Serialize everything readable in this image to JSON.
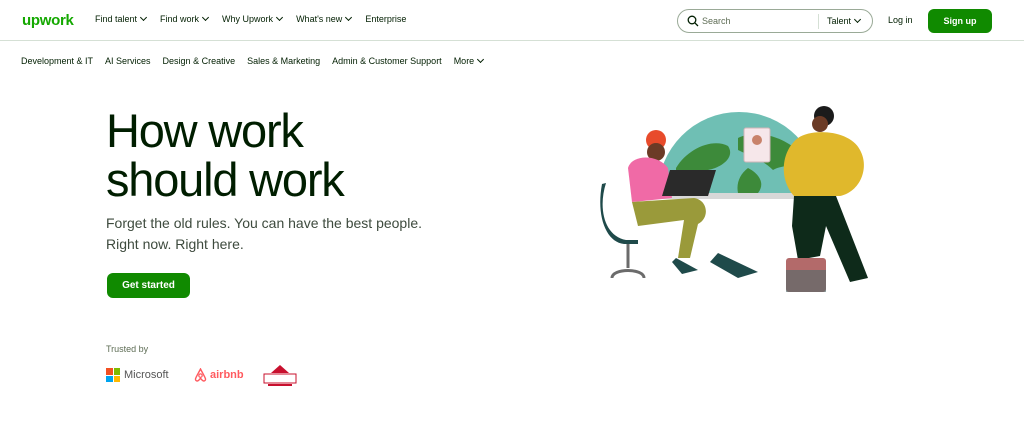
{
  "header": {
    "logo": "upwork",
    "nav": [
      {
        "label": "Find talent",
        "has_menu": true
      },
      {
        "label": "Find work",
        "has_menu": true
      },
      {
        "label": "Why Upwork",
        "has_menu": true
      },
      {
        "label": "What's new",
        "has_menu": true
      },
      {
        "label": "Enterprise",
        "has_menu": false
      }
    ],
    "search": {
      "placeholder": "Search",
      "scope": "Talent"
    },
    "login": "Log in",
    "signup": "Sign up"
  },
  "categories": [
    "Development & IT",
    "AI Services",
    "Design & Creative",
    "Sales & Marketing",
    "Admin & Customer Support",
    "More"
  ],
  "hero": {
    "headline_line1": "How work",
    "headline_line2": "should work",
    "subtext_line1": "Forget the old rules. You can have the best people.",
    "subtext_line2": "Right now. Right here.",
    "cta": "Get started"
  },
  "trusted": {
    "label": "Trusted by",
    "logos": [
      "Microsoft",
      "airbnb",
      "bissell"
    ]
  },
  "colors": {
    "brand_green": "#14a800",
    "button_green": "#108a00",
    "text": "#001e00"
  }
}
